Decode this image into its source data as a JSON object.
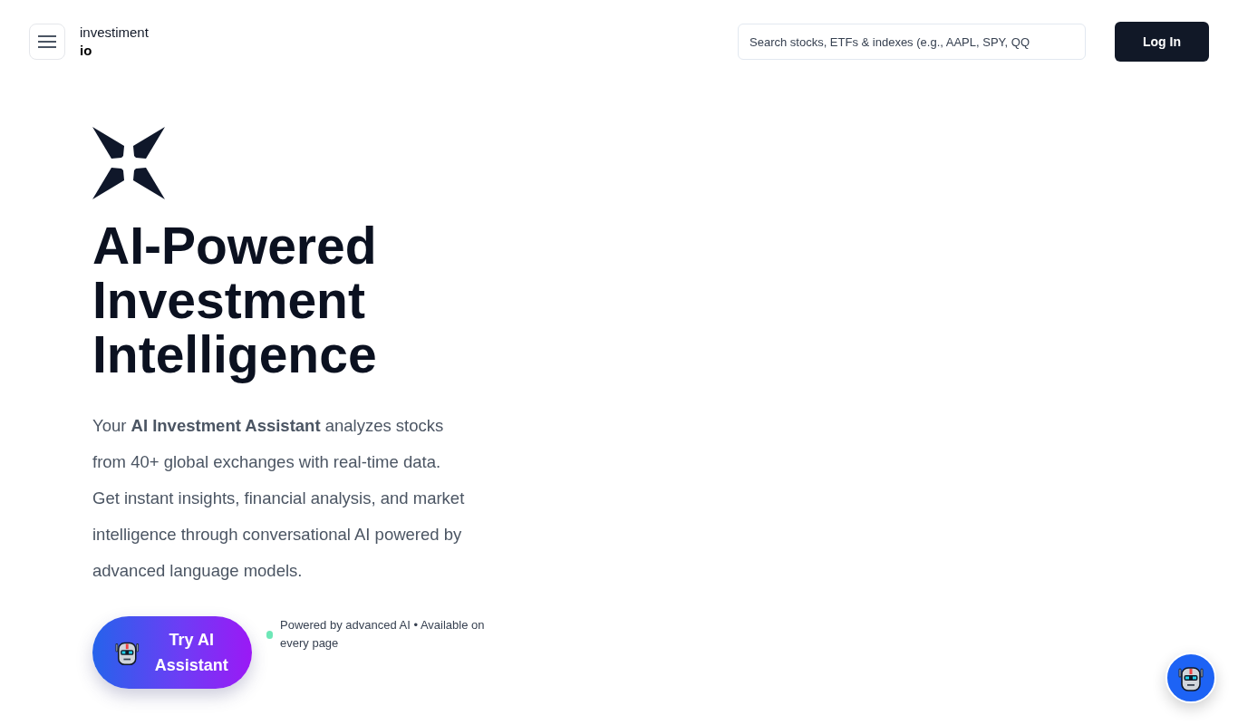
{
  "header": {
    "brand": {
      "name": "investiment",
      "suffix": "io"
    },
    "search": {
      "placeholder": "Search stocks, ETFs & indexes (e.g., AAPL, SPY, QQ"
    },
    "login_button": "Log In"
  },
  "hero": {
    "heading": "AI-Powered Investment Intelligence",
    "description": "Your **AI Investment Assistant** analyzes stocks from 40+ global exchanges with real-time data. Get instant insights, financial analysis, and market intelligence through conversational AI powered by advanced language models.",
    "cta_button": "Try AI Assistant",
    "note": "Powered by advanced AI • Available on every page"
  }
}
